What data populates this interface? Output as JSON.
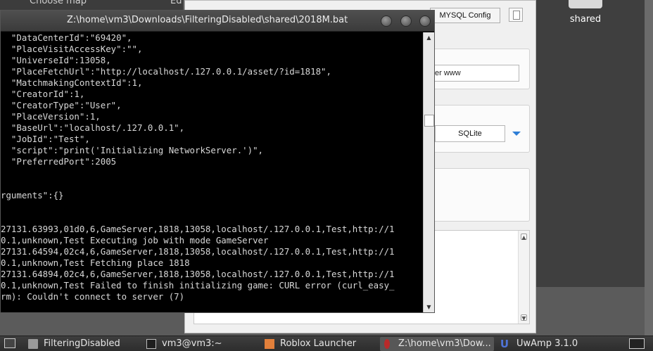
{
  "background": {
    "topbar_left": "Choose map",
    "topbar_right": "Ed",
    "desktop_icon_label": "shared"
  },
  "uwamp": {
    "mysql_config_label": "MYSQL Config",
    "server_field_value": "er www",
    "db_select_value": "SQLite",
    "accent_color": "#2e7ed6"
  },
  "console": {
    "title": "Z:\\home\\vm3\\Downloads\\FilteringDisabled\\shared\\2018M.bat",
    "lines": [
      "  \"DataCenterId\":\"69420\",",
      "  \"PlaceVisitAccessKey\":\"\",",
      "  \"UniverseId\":13058,",
      "  \"PlaceFetchUrl\":\"http://localhost/.127.0.0.1/asset/?id=1818\",",
      "  \"MatchmakingContextId\":1,",
      "  \"CreatorId\":1,",
      "  \"CreatorType\":\"User\",",
      "  \"PlaceVersion\":1,",
      "  \"BaseUrl\":\"localhost/.127.0.0.1\",",
      "  \"JobId\":\"Test\",",
      "  \"script\":\"print('Initializing NetworkServer.')\",",
      "  \"PreferredPort\":2005",
      "",
      "",
      "rguments\":{}",
      "",
      "",
      "27131.63993,01d0,6,GameServer,1818,13058,localhost/.127.0.0.1,Test,http://1",
      "0.1,unknown,Test Executing job with mode GameServer",
      "27131.64594,02c4,6,GameServer,1818,13058,localhost/.127.0.0.1,Test,http://1",
      "0.1,unknown,Test Fetching place 1818",
      "27131.64894,02c4,6,GameServer,1818,13058,localhost/.127.0.0.1,Test,http://1",
      "0.1,unknown,Test Failed to finish initializing game: CURL error (curl_easy_",
      "rm): Couldn't connect to server (7)"
    ]
  },
  "taskbar": {
    "items": [
      {
        "label": "FilteringDisabled",
        "icon": "folder-icon"
      },
      {
        "label": "vm3@vm3:~",
        "icon": "terminal-icon"
      },
      {
        "label": "Roblox Launcher",
        "icon": "roblox-icon"
      },
      {
        "label": "Z:\\home\\vm3\\Dow...",
        "icon": "bat-icon"
      },
      {
        "label": "UwAmp 3.1.0",
        "icon": "uwamp-icon"
      }
    ]
  }
}
